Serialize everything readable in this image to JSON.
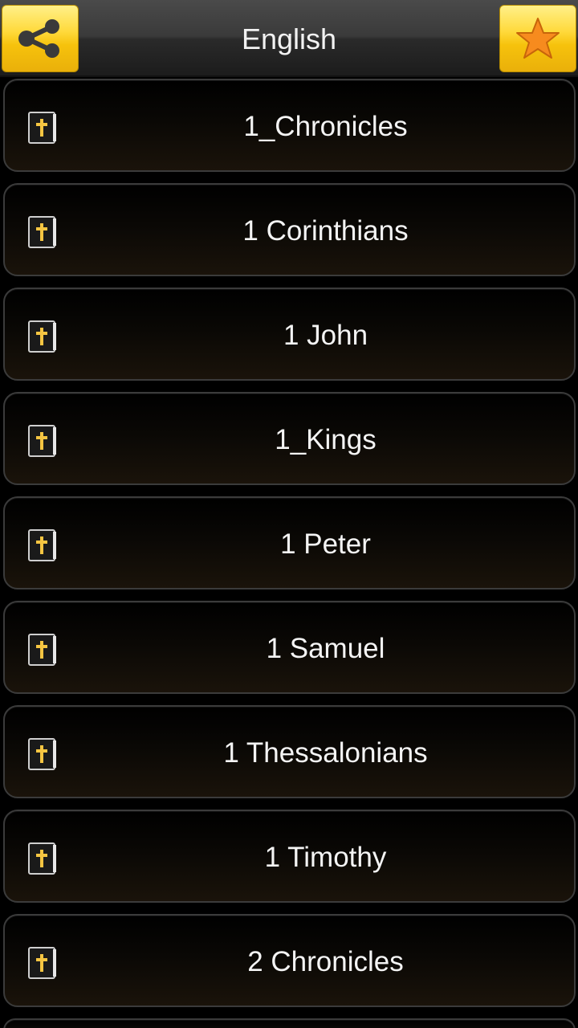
{
  "header": {
    "title": "English",
    "share_icon": "share-icon",
    "favorite_icon": "star-icon"
  },
  "books": [
    {
      "label": "1_Chronicles",
      "icon": "bible-book-icon"
    },
    {
      "label": "1 Corinthians",
      "icon": "bible-book-icon"
    },
    {
      "label": "1 John",
      "icon": "bible-book-icon"
    },
    {
      "label": "1_Kings",
      "icon": "bible-book-icon"
    },
    {
      "label": "1 Peter",
      "icon": "bible-book-icon"
    },
    {
      "label": "1 Samuel",
      "icon": "bible-book-icon"
    },
    {
      "label": "1 Thessalonians",
      "icon": "bible-book-icon"
    },
    {
      "label": "1 Timothy",
      "icon": "bible-book-icon"
    },
    {
      "label": "2 Chronicles",
      "icon": "bible-book-icon"
    }
  ],
  "colors": {
    "accent_yellow": "#ffd93a",
    "star_orange": "#f78b1e",
    "cross_gold": "#f5c542"
  }
}
